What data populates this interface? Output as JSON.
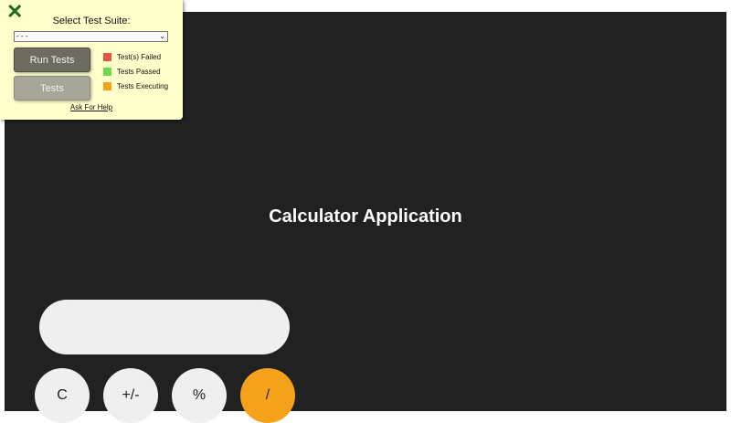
{
  "panel": {
    "close_icon": "close-x-icon",
    "close_glyph": "✕",
    "suite_label": "Select Test Suite:",
    "suite_selected": "- - -",
    "run_tests_label": "Run Tests",
    "tests_label": "Tests",
    "legend": [
      {
        "label": "Test(s) Failed",
        "color": "#e8553f"
      },
      {
        "label": "Tests Passed",
        "color": "#6fd84f"
      },
      {
        "label": "Tests Executing",
        "color": "#f5a11a"
      }
    ],
    "help_link": "Ask For Help"
  },
  "app": {
    "title": "Calculator Application",
    "display_value": "",
    "buttons": [
      {
        "label": "C",
        "color": "#efefef"
      },
      {
        "label": "+/-",
        "color": "#efefef"
      },
      {
        "label": "%",
        "color": "#efefef"
      },
      {
        "label": "/",
        "color": "#f5a11a"
      }
    ]
  }
}
